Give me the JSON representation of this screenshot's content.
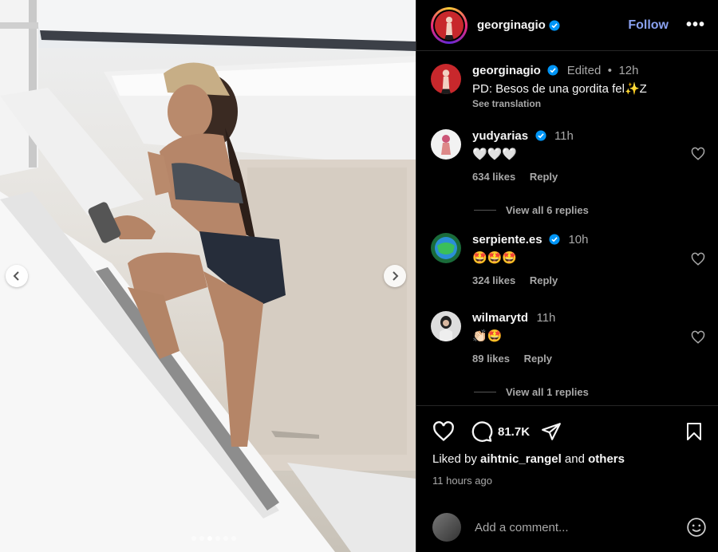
{
  "post": {
    "author": "georginagio",
    "follow_label": "Follow",
    "more_label": "•••",
    "caption": {
      "username": "georginagio",
      "edited": "Edited",
      "separator": "•",
      "time": "12h",
      "text": "PD: Besos de una gordita fel✨Z",
      "see_translation": "See translation"
    },
    "carousel": {
      "slides": 6,
      "active_slide": 3
    }
  },
  "comments": [
    {
      "username": "yudyarias",
      "verified": true,
      "time": "11h",
      "text": "🤍🤍🤍",
      "likes": "634 likes",
      "reply": "Reply",
      "view_replies": "View all 6 replies"
    },
    {
      "username": "serpiente.es",
      "verified": true,
      "time": "10h",
      "text": "🤩🤩🤩",
      "likes": "324 likes",
      "reply": "Reply"
    },
    {
      "username": "wilmarytd",
      "verified": false,
      "time": "11h",
      "text": "👏🏻🤩",
      "likes": "89 likes",
      "reply": "Reply",
      "view_replies": "View all 1 replies"
    }
  ],
  "footer": {
    "comment_count": "81.7K",
    "liked_by_prefix": "Liked by",
    "liked_by_user": "aihtnic_rangel",
    "liked_by_and": "and",
    "liked_by_others": "others",
    "timestamp": "11 hours ago",
    "add_comment_placeholder": "Add a comment..."
  },
  "colors": {
    "follow": "#8aa1f0",
    "verified": "#0095f6",
    "background": "#000000",
    "muted": "#a8a8a8"
  },
  "icons": [
    "chevron-left-icon",
    "chevron-right-icon",
    "verified-badge-icon",
    "more-icon",
    "heart-icon",
    "comment-icon",
    "share-icon",
    "bookmark-icon",
    "emoji-icon"
  ]
}
